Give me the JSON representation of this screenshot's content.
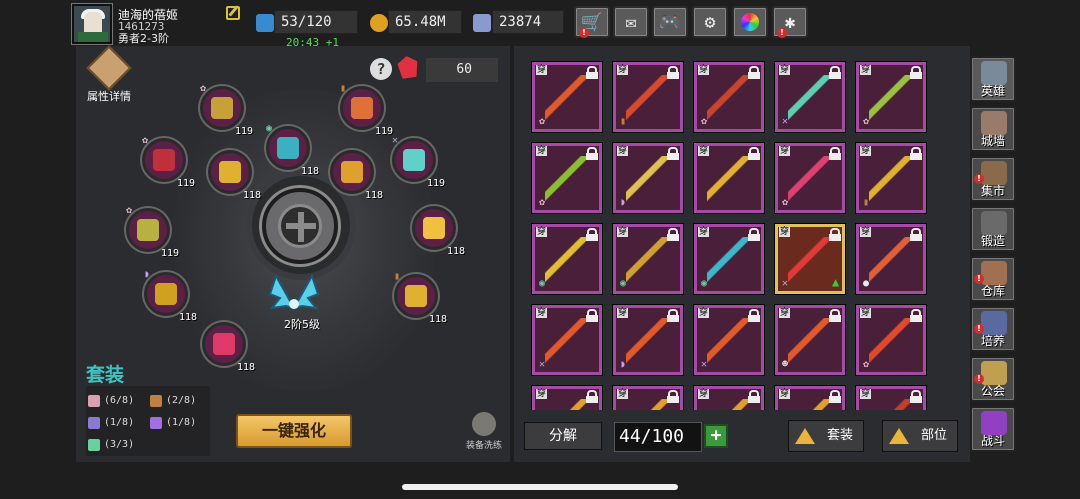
{
  "player": {
    "name": "迪海的蓓姬",
    "id": "1461273",
    "rank": "勇者2-3阶"
  },
  "resources": {
    "stamina": "53/120",
    "timer": "20:43 +1",
    "gold": "65.48M",
    "gems": "23874"
  },
  "left": {
    "attr_label": "属性详情",
    "gem_count": "60",
    "slots": [
      {
        "level": "119",
        "color": "#c7a03a",
        "mark": "flower"
      },
      {
        "level": "119",
        "color": "#e0703a",
        "mark": "totem"
      },
      {
        "level": "119",
        "color": "#c0303a",
        "mark": "flower"
      },
      {
        "level": "118",
        "color": "#3ab0c0",
        "mark": "eye"
      },
      {
        "level": "118",
        "color": "#e0b030",
        "mark": ""
      },
      {
        "level": "119",
        "color": "#60d0c8",
        "mark": "cross"
      },
      {
        "level": "119",
        "color": "#b8b040",
        "mark": "flower"
      },
      {
        "level": "118",
        "color": "#e0a030",
        "mark": ""
      },
      {
        "level": "118",
        "color": "#d0a020",
        "mark": "mask"
      },
      {
        "level": "118",
        "color": "#f0c040",
        "mark": ""
      },
      {
        "level": "118",
        "color": "#e03a6a",
        "mark": ""
      },
      {
        "level": "118",
        "color": "#e0b030",
        "mark": "totem"
      }
    ],
    "wings_label": "2阶5级",
    "set_title": "套装",
    "sets": [
      {
        "label": "(6/8)",
        "color": "#d8a0b0"
      },
      {
        "label": "(2/8)",
        "color": "#c08040"
      },
      {
        "label": "(1/8)",
        "color": "#8a7ad0"
      },
      {
        "label": "(1/8)",
        "color": "#a070e0"
      },
      {
        "label": "(3/3)",
        "color": "#6ad0a0"
      }
    ],
    "strengthen": "一键强化",
    "wash": "装备洗练"
  },
  "grid": {
    "wear": "穿",
    "items": [
      {
        "color": "#e05a2a",
        "mark": "flower",
        "sel": false,
        "up": false
      },
      {
        "color": "#d84a2a",
        "mark": "totem",
        "sel": false,
        "up": false
      },
      {
        "color": "#c8442a",
        "mark": "flower",
        "sel": false,
        "up": false
      },
      {
        "color": "#5ad0b0",
        "mark": "cross",
        "sel": false,
        "up": false
      },
      {
        "color": "#9ac040",
        "mark": "flower",
        "sel": false,
        "up": false
      },
      {
        "color": "#8ac030",
        "mark": "flower",
        "sel": false,
        "up": false
      },
      {
        "color": "#e0c050",
        "mark": "mask",
        "sel": false,
        "up": false
      },
      {
        "color": "#e0b030",
        "mark": "",
        "sel": false,
        "up": false
      },
      {
        "color": "#e04070",
        "mark": "flower",
        "sel": false,
        "up": false
      },
      {
        "color": "#e0b030",
        "mark": "totem",
        "sel": false,
        "up": false
      },
      {
        "color": "#e0c030",
        "mark": "eye",
        "sel": false,
        "up": false
      },
      {
        "color": "#d0a030",
        "mark": "eye",
        "sel": false,
        "up": false
      },
      {
        "color": "#3ab8c8",
        "mark": "eye",
        "sel": false,
        "up": false
      },
      {
        "color": "#e03a3a",
        "mark": "cross",
        "sel": true,
        "up": true
      },
      {
        "color": "#e0603a",
        "mark": "ghost",
        "sel": false,
        "up": false
      },
      {
        "color": "#e05a2a",
        "mark": "cross",
        "sel": false,
        "up": false
      },
      {
        "color": "#e05a2a",
        "mark": "mask",
        "sel": false,
        "up": false
      },
      {
        "color": "#e05a2a",
        "mark": "cross",
        "sel": false,
        "up": false
      },
      {
        "color": "#e05a2a",
        "mark": "skull",
        "sel": false,
        "up": false
      },
      {
        "color": "#e04a2a",
        "mark": "flower",
        "sel": false,
        "up": false
      },
      {
        "color": "#e0a030",
        "mark": "",
        "sel": false,
        "up": false
      },
      {
        "color": "#e0a030",
        "mark": "",
        "sel": false,
        "up": false
      },
      {
        "color": "#e0a030",
        "mark": "",
        "sel": false,
        "up": false
      },
      {
        "color": "#e0a030",
        "mark": "",
        "sel": false,
        "up": false
      },
      {
        "color": "#c0402a",
        "mark": "",
        "sel": false,
        "up": false
      }
    ]
  },
  "bottom": {
    "decompose": "分解",
    "count": "44/100",
    "plus": "+",
    "set_sort": "套装",
    "slot_sort": "部位"
  },
  "nav": [
    {
      "label": "英雄",
      "color": "#7a8a9a",
      "alert": false,
      "active": true
    },
    {
      "label": "城墙",
      "color": "#9a7a6a",
      "alert": false,
      "active": false
    },
    {
      "label": "集市",
      "color": "#8a6a4a",
      "alert": true,
      "active": false
    },
    {
      "label": "锻造",
      "color": "#6a6a6a",
      "alert": false,
      "active": false
    },
    {
      "label": "仓库",
      "color": "#a07050",
      "alert": true,
      "active": false
    },
    {
      "label": "培养",
      "color": "#5a6aa0",
      "alert": true,
      "active": false
    },
    {
      "label": "公会",
      "color": "#c0a050",
      "alert": true,
      "active": false
    },
    {
      "label": "战斗",
      "color": "#9040c0",
      "alert": false,
      "active": false
    }
  ]
}
